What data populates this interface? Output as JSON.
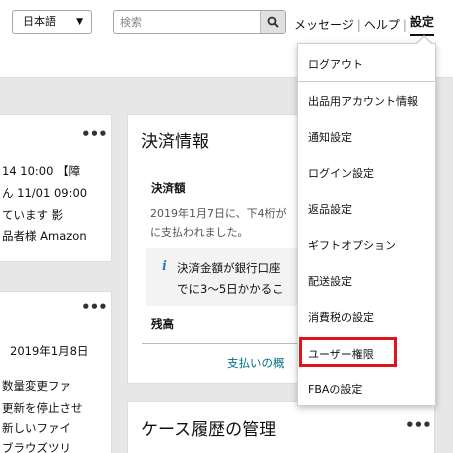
{
  "header": {
    "language": "日本語",
    "search_placeholder": "検索",
    "nav": {
      "messages": "メッセージ",
      "help": "ヘルプ",
      "settings": "設定",
      "separator": "|"
    }
  },
  "left_card_top": {
    "lines": [
      "14 10:00 【障",
      "ん 11/01 09:00",
      "ています 影",
      "品者様 Amazon"
    ]
  },
  "left_card_bottom": {
    "date": "2019年1月8日",
    "lines": [
      "数量変更ファ",
      "更新を停止させ",
      "新しいファイ",
      "ブラウズツリ"
    ]
  },
  "payment_card": {
    "title": "決済情報",
    "amount_label": "決済額",
    "amount_text_1": "2019年1月7日に、下4桁が",
    "amount_text_2": "に支払われました。",
    "info_icon": "i",
    "info_text_1": "決済金額が銀行口座",
    "info_text_2": "でに3～5日かかるこ",
    "balance_label": "残高",
    "summary_link": "支払いの概"
  },
  "case_card": {
    "title": "ケース履歴の管理"
  },
  "settings_menu": {
    "items": [
      "ログアウト",
      "出品用アカウント情報",
      "通知設定",
      "ログイン設定",
      "返品設定",
      "ギフトオプション",
      "配送設定",
      "消費税の設定",
      "ユーザー権限",
      "FBAの設定"
    ]
  },
  "icons": {
    "search": "search-icon",
    "caret": "chevron-down-icon",
    "more": "more-options-icon",
    "info": "info-icon"
  },
  "colors": {
    "highlight": "#e3131b",
    "link": "#00708a",
    "info": "#3b7bb7"
  }
}
